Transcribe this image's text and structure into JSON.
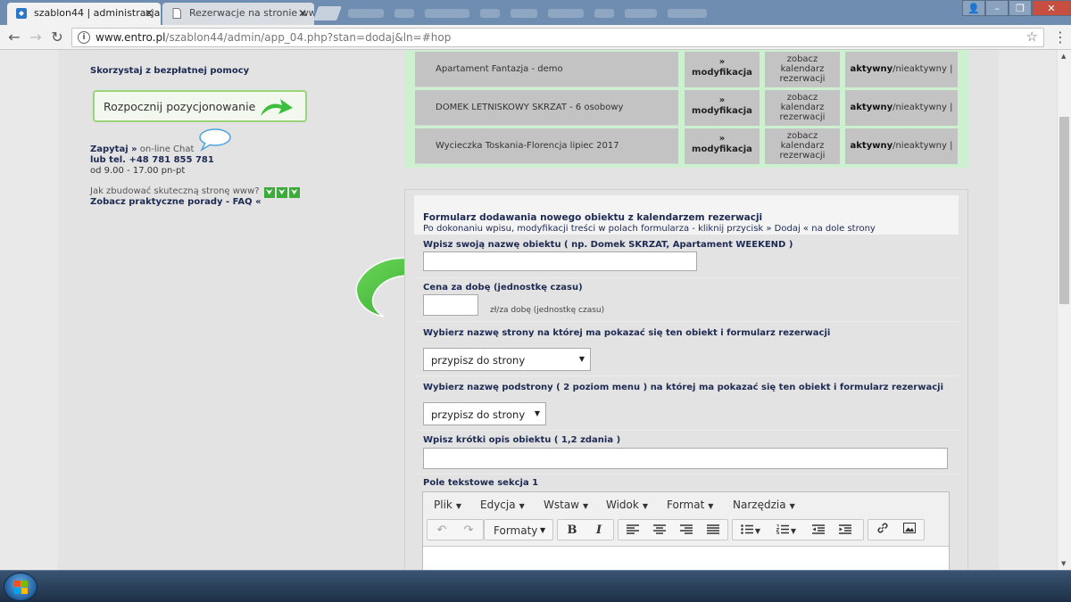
{
  "browser": {
    "tabs": [
      {
        "title": "szablon44 | administracja",
        "active": true
      },
      {
        "title": "Rezerwacje na stronie ww",
        "active": false
      }
    ],
    "url": {
      "host": "www.entro.pl",
      "path": "/szablon44/admin/app_04.php?stan=dodaj&ln=#hop"
    }
  },
  "sidebar": {
    "help_heading": "Skorzystaj z bezpłatnej pomocy",
    "seo_button": "Rozpocznij pozycjonowanie",
    "ask_label": "Zapytaj »",
    "ask_suffix": " on-line Chat",
    "phone": "lub tel. +48 781 855 781",
    "hours": "od 9.00 - 17.00 pn-pt",
    "howto": "Jak zbudować skuteczną stronę www?",
    "faq": "Zobacz praktyczne porady - FAQ «"
  },
  "objects": [
    {
      "name": "Apartament Fantazja - demo",
      "mod_arrow": "»",
      "mod_label": "modyfikacja",
      "cal1": "zobacz",
      "cal2": "kalendarz",
      "cal3": "rezerwacji",
      "active": "aktywny",
      "inactive": "/nieaktywny |"
    },
    {
      "name": "DOMEK LETNISKOWY SKRZAT - 6 osobowy",
      "mod_arrow": "»",
      "mod_label": "modyfikacja",
      "cal1": "zobacz",
      "cal2": "kalendarz",
      "cal3": "rezerwacji",
      "active": "aktywny",
      "inactive": "/nieaktywny |"
    },
    {
      "name": "Wycieczka Toskania-Florencja lipiec 2017",
      "mod_arrow": "»",
      "mod_label": "modyfikacja",
      "cal1": "zobacz",
      "cal2": "kalendarz",
      "cal3": "rezerwacji",
      "active": "aktywny",
      "inactive": "/nieaktywny |"
    }
  ],
  "form": {
    "title": "Formularz dodawania nowego obiektu z kalendarzem rezerwacji",
    "subtitle": "Po dokonaniu wpisu, modyfikacji treści w polach formularza - kliknij przycisk » Dodaj « na dole strony",
    "name_label": "Wpisz swoją nazwę obiektu ( np. Domek SKRZAT, Apartament WEEKEND )",
    "name_value": "",
    "price_label": "Cena za dobę (jednostkę czasu)",
    "price_value": "",
    "price_unit": "zł/za dobę (jednostkę czasu)",
    "page_label": "Wybierz nazwę strony na której ma pokazać się ten obiekt i formularz rezerwacji",
    "page_select": "przypisz do strony",
    "subpage_label": "Wybierz nazwę podstrony ( 2 poziom menu ) na której ma pokazać się ten obiekt i formularz rezerwacji",
    "subpage_select": "przypisz do strony",
    "desc_label": "Wpisz krótki opis obiektu ( 1,2 zdania )",
    "desc_value": "",
    "text1_label": "Pole tekstowe sekcja 1"
  },
  "editor": {
    "menu": [
      "Plik",
      "Edycja",
      "Wstaw",
      "Widok",
      "Format",
      "Narzędzia"
    ],
    "formats_label": "Formaty",
    "bold": "B",
    "italic": "I"
  },
  "colors": {
    "accent_green": "#3cbf3c",
    "table_bg": "#ccf0d0",
    "cell_bg": "#c3c3c3",
    "label_navy": "#1d2a52",
    "close_red": "#c74f42"
  }
}
